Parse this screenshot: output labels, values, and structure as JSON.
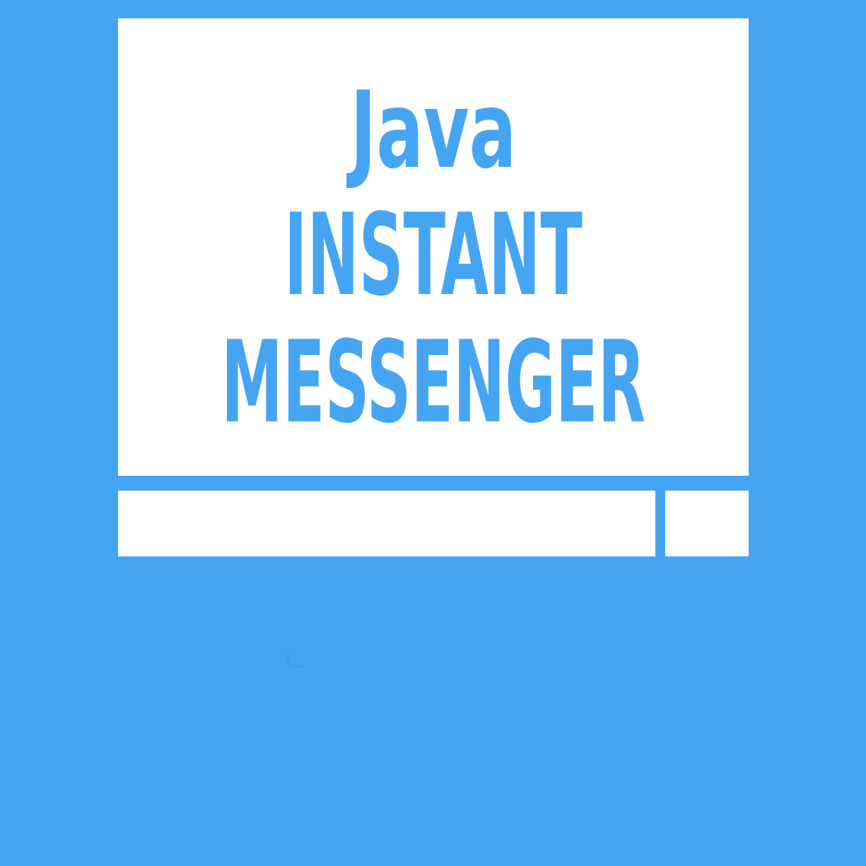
{
  "app": {
    "title_lines": [
      "Java",
      "INSTANT",
      "MESSENGER"
    ]
  },
  "composer": {
    "message_value": "",
    "message_placeholder": "",
    "send_label": ""
  },
  "colors": {
    "background": "#46a5f3",
    "panel": "#ffffff",
    "accent_text": "#46a5f3"
  }
}
